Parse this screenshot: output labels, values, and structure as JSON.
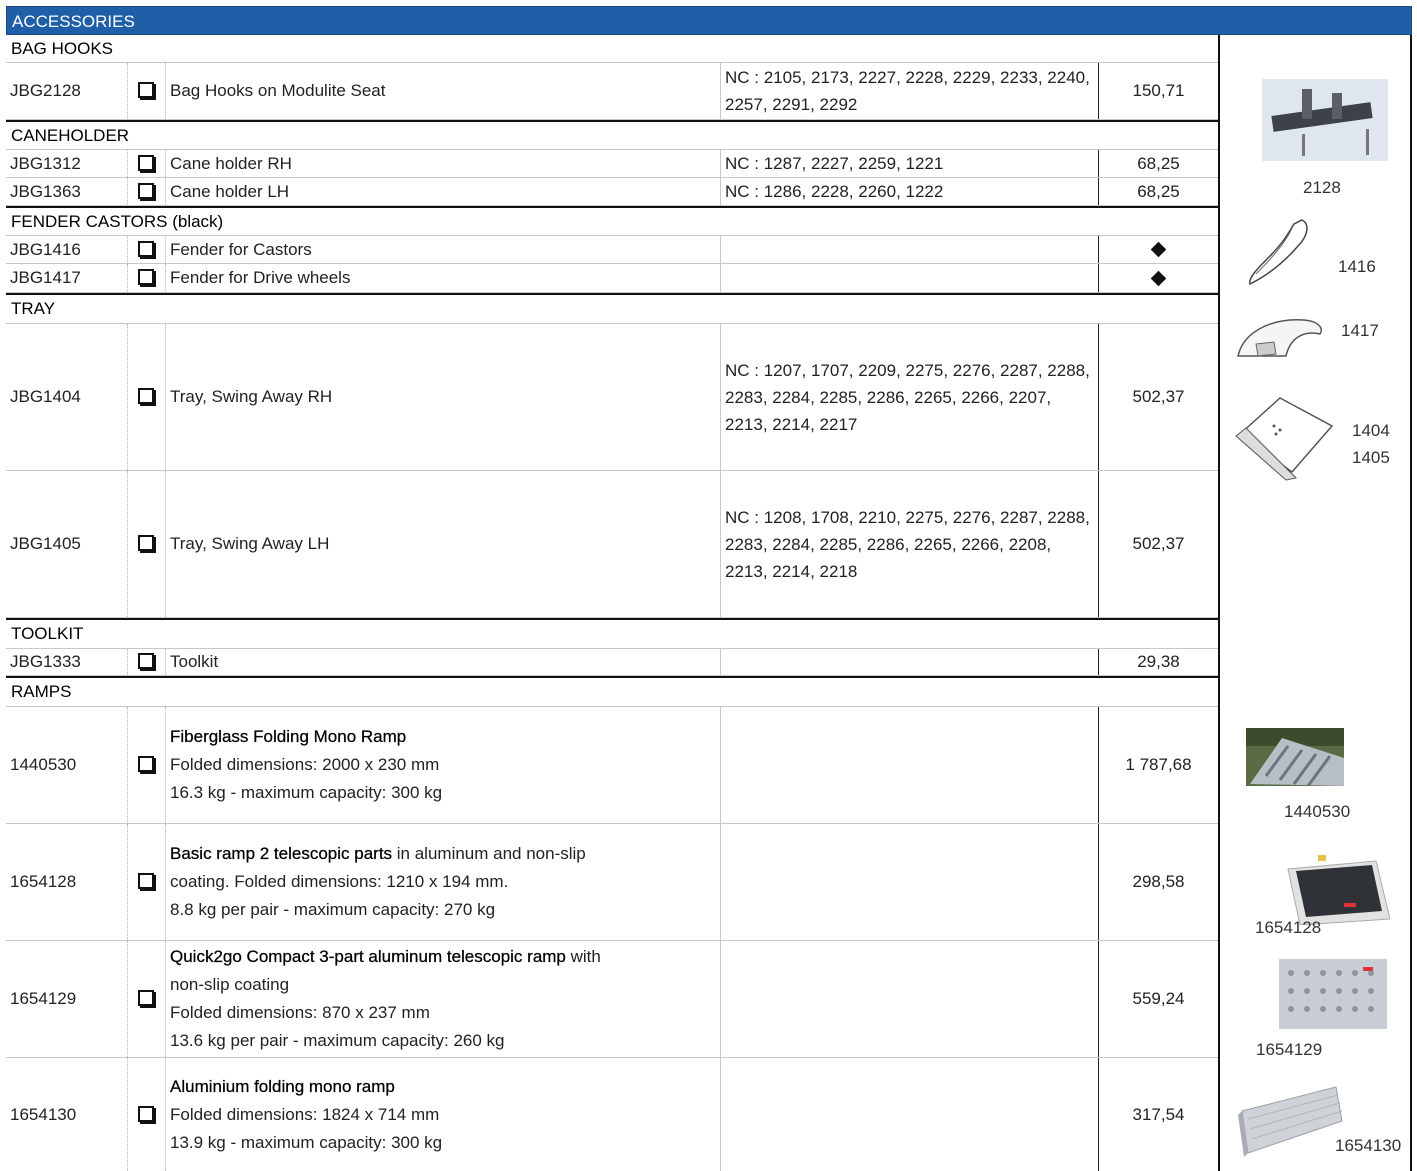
{
  "header": {
    "title": "ACCESSORIES"
  },
  "sections": {
    "bag_hooks": "BAG HOOKS",
    "caneholder": "CANEHOLDER",
    "fender": "FENDER CASTORS (black)",
    "tray": "TRAY",
    "toolkit": "TOOLKIT",
    "ramps": "RAMPS"
  },
  "rows": {
    "jbg2128": {
      "code": "JBG2128",
      "desc": "Bag Hooks on Modulite Seat",
      "nc": "NC : 2105, 2173, 2227, 2228, 2229, 2233, 2240, 2257, 2291, 2292",
      "price": "150,71"
    },
    "jbg1312": {
      "code": "JBG1312",
      "desc": "Cane holder RH",
      "nc": "NC : 1287, 2227, 2259, 1221",
      "price": "68,25"
    },
    "jbg1363": {
      "code": "JBG1363",
      "desc": "Cane holder LH",
      "nc": "NC : 1286, 2228, 2260, 1222",
      "price": "68,25"
    },
    "jbg1416": {
      "code": "JBG1416",
      "desc": "Fender for Castors",
      "nc": "",
      "price_symbol": "diamond"
    },
    "jbg1417": {
      "code": "JBG1417",
      "desc": "Fender for Drive wheels",
      "nc": "",
      "price_symbol": "diamond"
    },
    "jbg1404": {
      "code": "JBG1404",
      "desc": "Tray, Swing Away RH",
      "nc": "NC : 1207, 1707, 2209, 2275, 2276, 2287, 2288, 2283, 2284, 2285, 2286, 2265, 2266, 2207, 2213, 2214, 2217",
      "price": "502,37"
    },
    "jbg1405": {
      "code": "JBG1405",
      "desc": "Tray, Swing Away LH",
      "nc": "NC : 1208, 1708, 2210, 2275, 2276, 2287, 2288, 2283, 2284, 2285, 2286, 2265, 2266, 2208, 2213, 2214, 2218",
      "price": "502,37"
    },
    "jbg1333": {
      "code": "JBG1333",
      "desc": "Toolkit",
      "nc": "",
      "price": "29,38"
    },
    "r1440530": {
      "code": "1440530",
      "title": "Fiberglass Folding Mono Ramp",
      "line1": "Folded dimensions: 2000 x 230 mm",
      "line2": "16.3 kg - maximum capacity: 300 kg",
      "price": "1 787,68"
    },
    "r1654128": {
      "code": "1654128",
      "title": "Basic ramp 2 telescopic parts",
      "title_rest": " in aluminum and non-slip",
      "line1": "coating. Folded dimensions: 1210 x 194 mm.",
      "line2": "8.8 kg per pair - maximum capacity: 270 kg",
      "price": "298,58"
    },
    "r1654129": {
      "code": "1654129",
      "title": "Quick2go Compact 3-part aluminum telescopic ramp",
      "title_rest": " with",
      "line0": "non-slip coating",
      "line1": "Folded dimensions: 870 x 237 mm",
      "line2": "13.6 kg per pair - maximum capacity: 260 kg",
      "price": "559,24"
    },
    "r1654130": {
      "code": "1654130",
      "title": "Aluminium folding mono ramp",
      "line1": "Folded dimensions: 1824 x 714 mm",
      "line2": "13.9 kg - maximum capacity: 300 kg",
      "price": "317,54"
    }
  },
  "image_labels": {
    "i2128": "2128",
    "i1416": "1416",
    "i1417": "1417",
    "i1404": "1404",
    "i1405": "1405",
    "i1440530": "1440530",
    "i1654128": "1654128",
    "i1654129": "1654129",
    "i1654130": "1654130"
  },
  "colors": {
    "header_bg": "#1f5fa8",
    "header_text": "#ffffff"
  }
}
